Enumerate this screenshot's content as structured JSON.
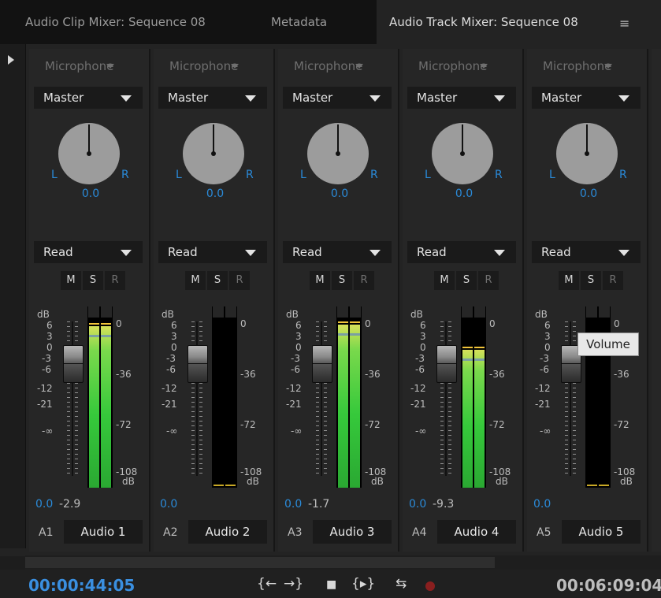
{
  "tabs": [
    {
      "label": "Audio Clip Mixer: Sequence 08",
      "active": false
    },
    {
      "label": "Metadata",
      "active": false
    },
    {
      "label": "Audio Track Mixer: Sequence 08",
      "active": true
    }
  ],
  "tab_menu_icon": "≡",
  "tracks": [
    {
      "input": "Microphone",
      "output": "Master",
      "pan_value": "0.0",
      "mode": "Read",
      "m": "M",
      "s": "S",
      "r": "R",
      "vol_value": "0.0",
      "peak_value": "-2.9",
      "id": "A1",
      "name": "Audio 1",
      "level_fraction": 0.95
    },
    {
      "input": "Microphone",
      "output": "Master",
      "pan_value": "0.0",
      "mode": "Read",
      "m": "M",
      "s": "S",
      "r": "R",
      "vol_value": "0.0",
      "peak_value": "",
      "id": "A2",
      "name": "Audio 2",
      "level_fraction": 0.0
    },
    {
      "input": "Microphone",
      "output": "Master",
      "pan_value": "0.0",
      "mode": "Read",
      "m": "M",
      "s": "S",
      "r": "R",
      "vol_value": "0.0",
      "peak_value": "-1.7",
      "id": "A3",
      "name": "Audio 3",
      "level_fraction": 0.96
    },
    {
      "input": "Microphone",
      "output": "Master",
      "pan_value": "0.0",
      "mode": "Read",
      "m": "M",
      "s": "S",
      "r": "R",
      "vol_value": "0.0",
      "peak_value": "-9.3",
      "id": "A4",
      "name": "Audio 4",
      "level_fraction": 0.81
    },
    {
      "input": "Microphone",
      "output": "Master",
      "pan_value": "0.0",
      "mode": "Read",
      "m": "M",
      "s": "S",
      "r": "R",
      "vol_value": "0.0",
      "peak_value": "",
      "id": "A5",
      "name": "Audio 5",
      "level_fraction": 0.0
    }
  ],
  "pan_labels": {
    "left": "L",
    "right": "R"
  },
  "fader_scale": {
    "unit": "dB",
    "ticks": [
      "6",
      "3",
      "0",
      "-3",
      "-6",
      "-12",
      "-21",
      "-∞"
    ]
  },
  "meter_scale": {
    "ticks": [
      "0",
      "-36",
      "-72",
      "-108"
    ],
    "unit": "dB"
  },
  "tooltip": "Volume",
  "timecode": {
    "current": "00:00:44:05",
    "duration": "00:06:09:04"
  },
  "transport_icons": [
    "go-to-in-icon",
    "go-to-out-icon",
    "stop-icon",
    "play-in-to-out-icon",
    "loop-icon",
    "record-icon"
  ],
  "colors": {
    "accent_blue": "#2a8ad8",
    "meter_green": "#36c93b",
    "peak_yellow": "#f2c53a",
    "record_red": "#8a1f1f"
  }
}
